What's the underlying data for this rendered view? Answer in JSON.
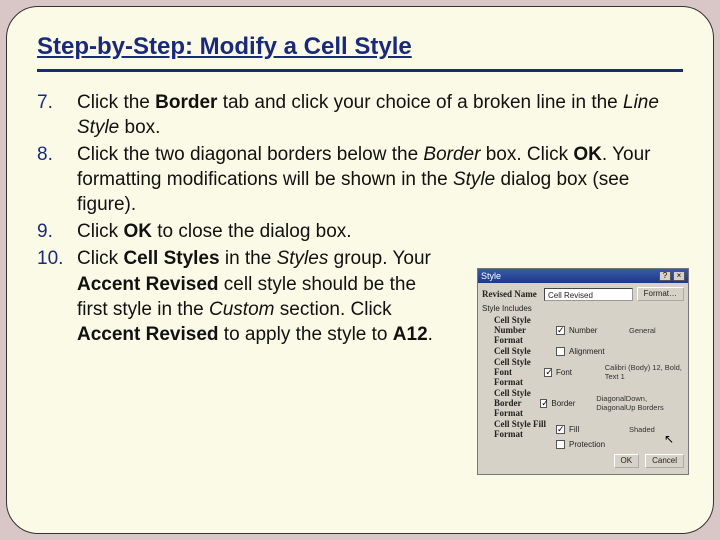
{
  "title": "Step-by-Step: Modify a Cell Style",
  "steps": {
    "s7": {
      "num": "7.",
      "p1": "Click the ",
      "b1": "Border",
      "p2": " tab and click your choice of a broken line in the ",
      "i1": "Line Style",
      "p3": " box."
    },
    "s8": {
      "num": "8.",
      "p1": "Click the two diagonal borders below the ",
      "i1": "Border",
      "p2": " box. Click ",
      "b1": "OK",
      "p3": ". Your formatting modifications will be shown in the ",
      "i2": "Style",
      "p4": " dialog box (see figure)."
    },
    "s9": {
      "num": "9.",
      "p1": "Click ",
      "b1": "OK",
      "p2": " to close the dialog box."
    },
    "s10": {
      "num": "10.",
      "p1": "Click ",
      "b1": "Cell Styles",
      "p2": " in the ",
      "i1": "Styles",
      "p3": " group. Your ",
      "b2": "Accent Revised",
      "p4": " cell style should be the first style in the ",
      "i2": "Custom",
      "p5": " section. Click ",
      "b3": "Accent Revised",
      "p6": " to apply the style to ",
      "b4": "A12",
      "p7": "."
    }
  },
  "dialog": {
    "title": "Style",
    "btn_help": "?",
    "btn_close": "×",
    "name_label": "Revised Name",
    "name_value": "Cell Revised",
    "format_btn": "Format…",
    "section": "Style Includes",
    "rows": {
      "num": {
        "lbl": "Cell Style Number Format",
        "opt": "Number",
        "val": "General"
      },
      "align": {
        "lbl": "Cell Style",
        "opt": "Alignment",
        "val": ""
      },
      "font": {
        "lbl": "Cell Style Font Format",
        "opt": "Font",
        "val": "Calibri (Body) 12, Bold, Text 1"
      },
      "brd": {
        "lbl": "Cell Style Border Format",
        "opt": "Border",
        "val": "DiagonalDown, DiagonalUp Borders"
      },
      "fill": {
        "lbl": "Cell Style Fill Format",
        "opt": "Fill",
        "val": "Shaded"
      },
      "prot": {
        "lbl": "",
        "opt": "Protection",
        "val": ""
      }
    },
    "ok": "OK",
    "cancel": "Cancel"
  }
}
